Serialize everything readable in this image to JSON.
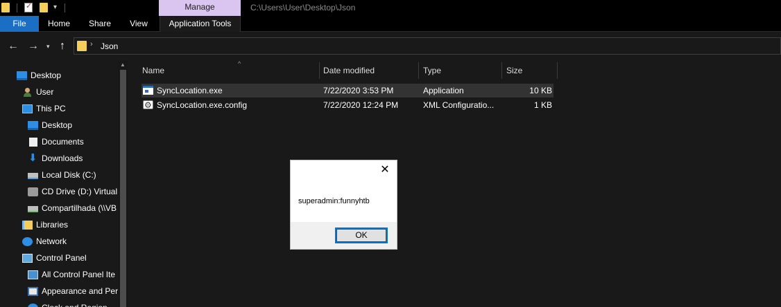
{
  "window": {
    "title_path": "C:\\Users\\User\\Desktop\\Json",
    "contextual_tab": "Manage"
  },
  "ribbon": {
    "tabs": [
      "File",
      "Home",
      "Share",
      "View",
      "Application Tools"
    ]
  },
  "address_bar": {
    "separator": "›",
    "crumb": "Json"
  },
  "sidebar": {
    "items": [
      {
        "label": "Desktop",
        "icon": "desktop-icon"
      },
      {
        "label": "User",
        "icon": "user-icon"
      },
      {
        "label": "This PC",
        "icon": "this-pc-icon"
      },
      {
        "label": "Desktop",
        "icon": "desktop-icon"
      },
      {
        "label": "Documents",
        "icon": "documents-icon"
      },
      {
        "label": "Downloads",
        "icon": "downloads-icon"
      },
      {
        "label": "Local Disk (C:)",
        "icon": "local-disk-icon"
      },
      {
        "label": "CD Drive (D:) Virtual",
        "icon": "cd-drive-icon"
      },
      {
        "label": "Compartilhada (\\\\VB",
        "icon": "network-drive-icon"
      },
      {
        "label": "Libraries",
        "icon": "libraries-icon"
      },
      {
        "label": "Network",
        "icon": "network-icon"
      },
      {
        "label": "Control Panel",
        "icon": "control-panel-icon"
      },
      {
        "label": "All Control Panel Ite",
        "icon": "control-panel-icon"
      },
      {
        "label": "Appearance and Per",
        "icon": "appearance-icon"
      },
      {
        "label": "Clock and Region",
        "icon": "clock-icon"
      }
    ]
  },
  "file_list": {
    "columns": [
      "Name",
      "Date modified",
      "Type",
      "Size"
    ],
    "rows": [
      {
        "name": "SyncLocation.exe",
        "date": "7/22/2020 3:53 PM",
        "type": "Application",
        "size": "10 KB",
        "icon": "application-icon"
      },
      {
        "name": "SyncLocation.exe.config",
        "date": "7/22/2020 12:24 PM",
        "type": "XML Configuratio...",
        "size": "1 KB",
        "icon": "config-file-icon"
      }
    ]
  },
  "dialog": {
    "message": "superadmin:funnyhtb",
    "ok_label": "OK",
    "close_glyph": "✕"
  },
  "colors": {
    "accent": "#1a6fc5",
    "manage_tab": "#dac5f0",
    "background": "#191919",
    "folder": "#f5cd5b"
  }
}
